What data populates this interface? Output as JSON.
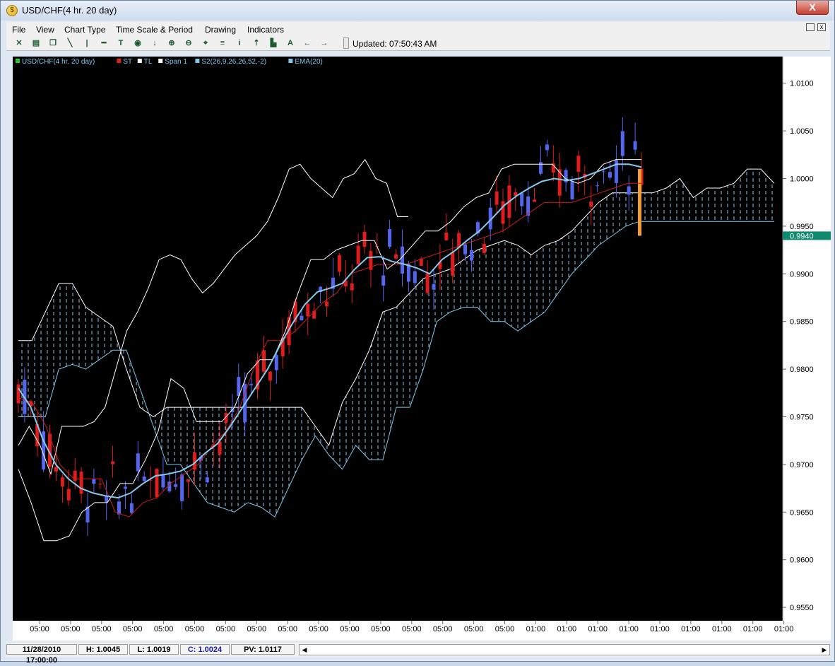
{
  "window": {
    "title": "USD/CHF(4 hr.  20 day)",
    "close_glyph": "X"
  },
  "menu": [
    "File",
    "View",
    "Chart Type",
    "Time Scale & Period",
    "Drawing",
    "Indicators"
  ],
  "toolbar": {
    "icons": [
      "cursor-icon",
      "print-icon",
      "copy-icon",
      "trendline-icon",
      "vertical-line-icon",
      "horizontal-line-icon",
      "text-icon",
      "circle-icon",
      "down-arrow-icon",
      "zoom-in-icon",
      "zoom-out-icon",
      "crosshair-icon",
      "fibonacci-icon",
      "info-icon",
      "arrow-up-icon",
      "bar-chart-icon",
      "letter-a-icon",
      "left-arrow-icon",
      "right-arrow-icon"
    ],
    "updated": "Updated: 07:50:43 AM"
  },
  "legend": [
    {
      "label": "USD/CHF(4 hr.  20 day)",
      "color": "#2ec92e"
    },
    {
      "label": "ST",
      "color": "#e02020"
    },
    {
      "label": "TL",
      "color": "#ffffff"
    },
    {
      "label": "Span 1",
      "color": "#ffffff"
    },
    {
      "label": "S2(26,9,26,26,52,-2)",
      "color": "#7ec8ea"
    },
    {
      "label": "EMA(20)",
      "color": "#7ec8ea"
    }
  ],
  "statusbar": {
    "date": "11/28/2010 17:00:00",
    "high": "H: 1.0045",
    "low": "L: 1.0019",
    "close": "C: 1.0024",
    "pv": "PV: 1.0117"
  },
  "chart_data": {
    "type": "candlestick",
    "y_ticks": [
      1.01,
      1.005,
      1.0,
      0.995,
      0.99,
      0.985,
      0.98,
      0.975,
      0.97,
      0.965,
      0.96,
      0.955
    ],
    "y_tick_labels": [
      "1.0100",
      "1.0050",
      "1.0000",
      "0.9950",
      "0.9900",
      "0.9850",
      "0.9800",
      "0.9750",
      "0.9700",
      "0.9650",
      "0.9600",
      "0.9550"
    ],
    "ylim": [
      0.9536,
      1.0128
    ],
    "x_tick_labels": [
      "05:00",
      "05:00",
      "05:00",
      "05:00",
      "05:00",
      "05:00",
      "05:00",
      "05:00",
      "05:00",
      "05:00",
      "05:00",
      "05:00",
      "05:00",
      "05:00",
      "05:00",
      "05:00",
      "01:00",
      "01:00",
      "01:00",
      "01:00",
      "01:00",
      "01:00",
      "01:00",
      "01:00",
      "01:00"
    ],
    "current_price": {
      "value": 0.994,
      "label": "0.9940",
      "color": "#0f8a6f"
    },
    "series_colors": {
      "up": "#5566ee",
      "down": "#e01c1c",
      "st": "#c81e1e",
      "tl": "#ffffff",
      "span1": "#ffffff",
      "span2": "#7ec8ea",
      "ema": "#86c8ec",
      "lastbar": "#f0a030"
    },
    "cloud_top": [
      0.983,
      0.983,
      0.986,
      0.989,
      0.989,
      0.9865,
      0.9855,
      0.9845,
      0.98,
      0.976,
      0.975,
      0.976,
      0.976,
      0.976,
      0.976,
      0.976,
      0.976,
      0.976,
      0.976,
      0.976,
      0.976,
      0.976,
      0.974,
      0.972,
      0.9765,
      0.979,
      0.982,
      0.986,
      0.9865,
      0.988,
      0.9895,
      0.99,
      0.9905,
      0.9915,
      0.9925,
      0.993,
      0.9935,
      0.993,
      0.992,
      0.993,
      0.9935,
      0.9945,
      0.996,
      0.9975,
      0.9985,
      0.9985,
      0.9985,
      0.9985,
      0.999,
      1.0,
      0.998,
      0.999,
      0.999,
      0.9995,
      1.001,
      1.001,
      0.9995
    ],
    "cloud_bottom": [
      0.975,
      0.975,
      0.975,
      0.98,
      0.9805,
      0.98,
      0.981,
      0.982,
      0.982,
      0.978,
      0.974,
      0.97,
      0.97,
      0.968,
      0.966,
      0.9655,
      0.965,
      0.966,
      0.9655,
      0.9645,
      0.9675,
      0.9705,
      0.973,
      0.971,
      0.9695,
      0.972,
      0.9705,
      0.9705,
      0.976,
      0.976,
      0.98,
      0.985,
      0.986,
      0.9865,
      0.9865,
      0.985,
      0.985,
      0.984,
      0.985,
      0.986,
      0.988,
      0.99,
      0.9915,
      0.993,
      0.994,
      0.995,
      0.9955,
      0.9955,
      0.9955,
      0.9955,
      0.9955,
      0.9955,
      0.9955,
      0.9955,
      0.9955,
      0.9955,
      0.9955
    ],
    "ema": [
      0.978,
      0.976,
      0.9725,
      0.97,
      0.9685,
      0.9675,
      0.967,
      0.9667,
      0.9665,
      0.967,
      0.968,
      0.9688,
      0.969,
      0.9693,
      0.97,
      0.9712,
      0.9722,
      0.974,
      0.976,
      0.978,
      0.98,
      0.9825,
      0.9848,
      0.9868,
      0.9881,
      0.9885,
      0.989,
      0.9905,
      0.9917,
      0.9918,
      0.9913,
      0.991,
      0.9906,
      0.99,
      0.9915,
      0.9924,
      0.9935,
      0.9945,
      0.9958,
      0.9972,
      0.9982,
      0.999,
      0.9997,
      1.0,
      0.9998,
      1.0,
      1.0005,
      1.001,
      1.0015,
      1.0015,
      1.0012
    ],
    "tenkan": [
      0.9695,
      0.966,
      0.962,
      0.962,
      0.9625,
      0.965,
      0.966,
      0.966,
      0.968,
      0.968,
      0.9705,
      0.9735,
      0.979,
      0.978,
      0.9745,
      0.9745,
      0.9745,
      0.976,
      0.9795,
      0.981,
      0.981,
      0.984,
      0.988,
      0.9915,
      0.9915,
      0.9925,
      0.993,
      0.9935,
      0.9935,
      0.9905,
      0.9915,
      0.993,
      0.9945,
      0.9945,
      0.9955,
      0.997,
      0.998,
      0.9985,
      1.001,
      1.0015,
      1.0015,
      1.0015,
      1.0015,
      1.0,
      0.9995,
      1.0,
      1.0015,
      1.002,
      1.002,
      1.002
    ],
    "kijun": [
      0.977,
      0.9765,
      0.974,
      0.97,
      0.9685,
      0.9685,
      0.9685,
      0.965,
      0.9645,
      0.966,
      0.9665,
      0.968,
      0.969,
      0.97,
      0.972,
      0.9735,
      0.976,
      0.98,
      0.983,
      0.983,
      0.984,
      0.9855,
      0.987,
      0.988,
      0.99,
      0.9905,
      0.991,
      0.991,
      0.991,
      0.9915,
      0.992,
      0.9925,
      0.993,
      0.9935,
      0.994,
      0.9945,
      0.9955,
      0.9965,
      0.9975,
      0.9975,
      0.9975,
      0.998,
      0.9985,
      0.999,
      0.9995,
      0.9995
    ],
    "chikou": [
      0.972,
      0.974,
      0.972,
      0.969,
      0.974,
      0.974,
      0.974,
      0.9745,
      0.976,
      0.98,
      0.984,
      0.986,
      0.9885,
      0.9915,
      0.992,
      0.9915,
      0.9895,
      0.988,
      0.989,
      0.9905,
      0.992,
      0.993,
      0.994,
      0.9955,
      0.998,
      1.001,
      1.0015,
      1.0,
      0.999,
      0.998,
      1.0,
      1.0005,
      1.002,
      1.0,
      0.9995,
      0.996,
      0.996
    ]
  }
}
